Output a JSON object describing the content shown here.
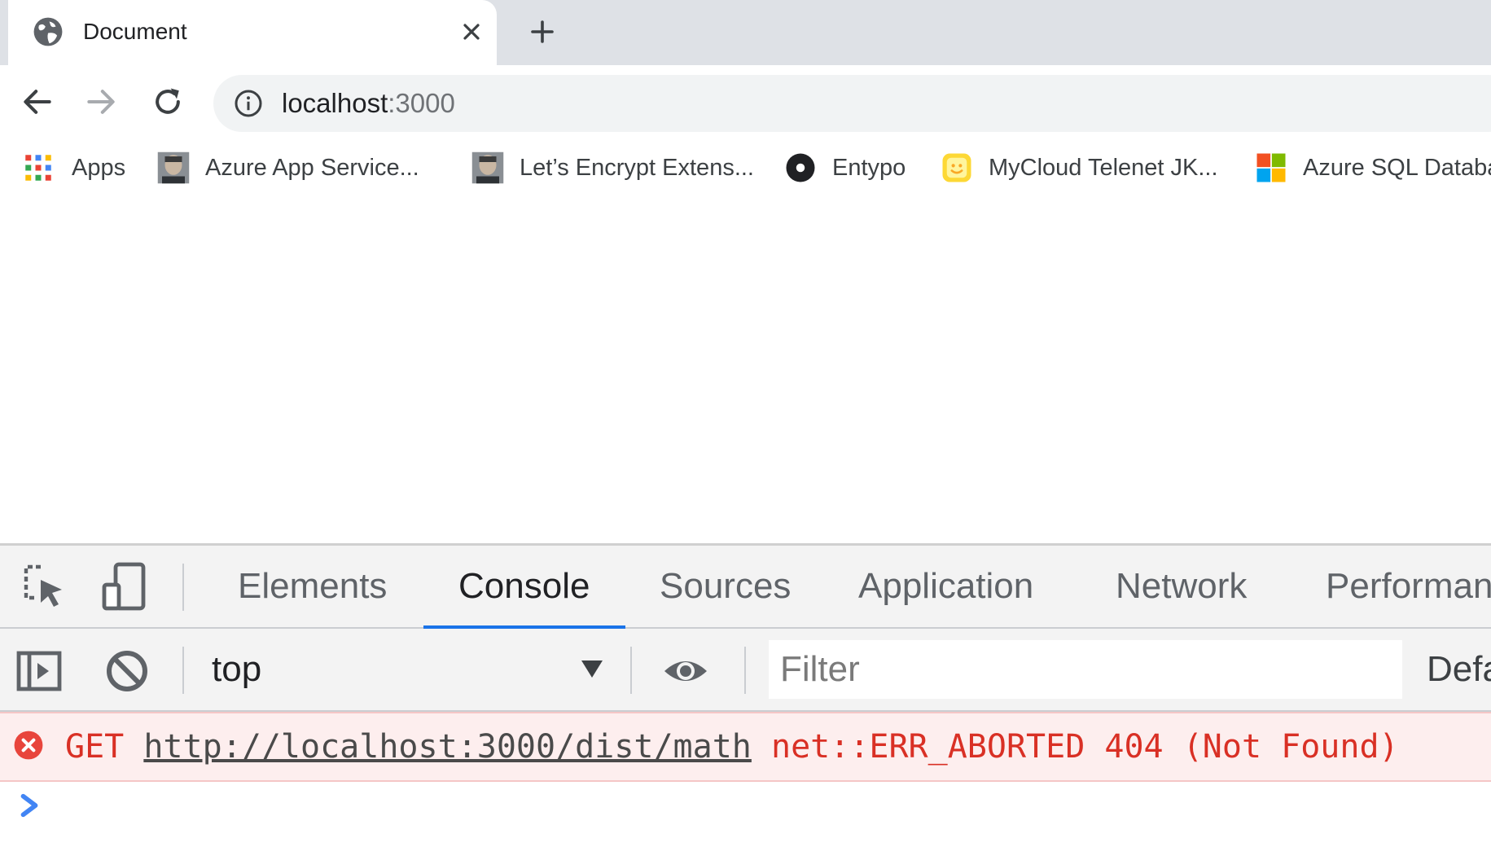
{
  "tab": {
    "title": "Document"
  },
  "omnibox": {
    "host": "localhost",
    "port": ":3000"
  },
  "bookmarks": [
    {
      "label": "Apps",
      "icon": "apps-grid-icon"
    },
    {
      "label": "Azure App Service...",
      "icon": "avatar-photo-icon"
    },
    {
      "label": "Let’s Encrypt Extens...",
      "icon": "avatar-photo-icon"
    },
    {
      "label": "Entypo",
      "icon": "entypo-icon"
    },
    {
      "label": "MyCloud Telenet JK...",
      "icon": "mycloud-smiley-icon"
    },
    {
      "label": "Azure SQL Databa",
      "icon": "microsoft-logo-icon"
    }
  ],
  "devtools": {
    "tabs": [
      "Elements",
      "Console",
      "Sources",
      "Application",
      "Network",
      "Performan"
    ],
    "active_tab": "Console",
    "context": "top",
    "filter_placeholder": "Filter",
    "levels_label": "Defa",
    "error": {
      "method": "GET",
      "url": "http://localhost:3000/dist/math",
      "message": "net::ERR_ABORTED 404 (Not Found)"
    }
  },
  "colors": {
    "tab_strip": "#dee1e6",
    "omnibox_bg": "#f1f3f4",
    "devtools_bar": "#f3f3f3",
    "active_tab_underline": "#1a73e8",
    "error_text": "#d93025",
    "error_bg": "#fdeeee",
    "prompt": "#4285f4"
  }
}
